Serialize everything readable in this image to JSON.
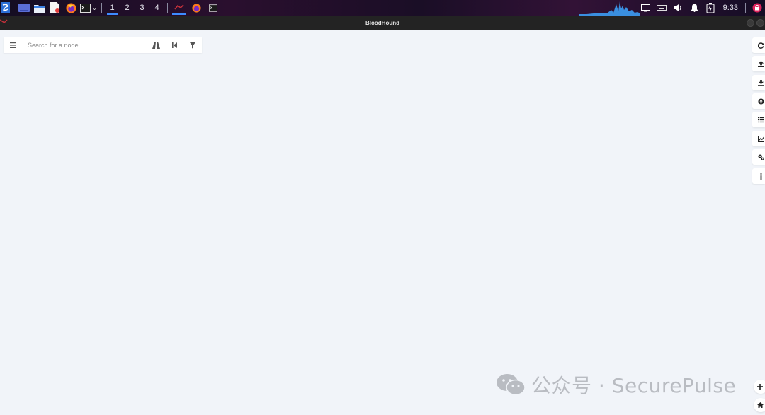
{
  "taskbar": {
    "workspaces": [
      "1",
      "2",
      "3",
      "4"
    ],
    "active_workspace": "1",
    "clock": "9:33",
    "accent": "#3d8bff"
  },
  "window": {
    "title": "BloodHound"
  },
  "search": {
    "placeholder": "Search for a node",
    "value": "",
    "icons": [
      "menu-icon",
      "pathfinding-icon",
      "back-icon",
      "filter-icon"
    ]
  },
  "right_toolbar": {
    "buttons": [
      "refresh-icon",
      "upload-icon",
      "export-icon",
      "upload-circle-icon",
      "list-icon",
      "chart-icon",
      "settings-icon",
      "info-icon"
    ]
  },
  "zoom_controls": [
    "zoom-in-icon",
    "home-icon"
  ],
  "watermark": {
    "text": "公众号 · SecurePulse"
  }
}
